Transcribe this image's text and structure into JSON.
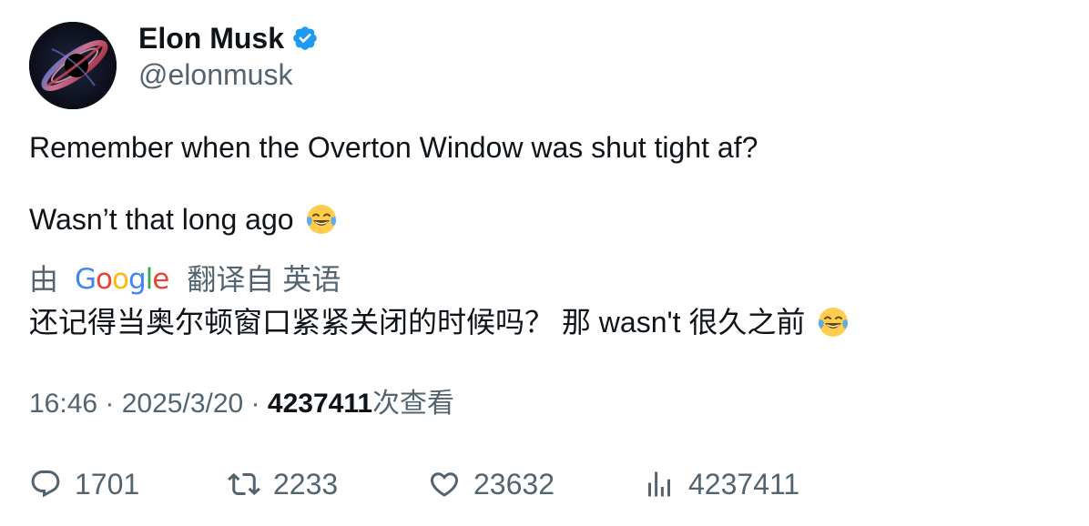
{
  "author": {
    "display_name": "Elon Musk",
    "handle": "@elonmusk",
    "verified": true,
    "verified_badge_color": "#1d9bf0"
  },
  "tweet": {
    "line1": "Remember when the Overton Window was shut tight af?",
    "line2": "Wasn’t that long ago",
    "line2_emoji": "face-with-tears-of-joy"
  },
  "translation": {
    "by_label": "由",
    "provider": [
      "G",
      "o",
      "o",
      "g",
      "l",
      "e"
    ],
    "from_label": "翻译自 英语",
    "text": "还记得当奥尔顿窗口紧紧关闭的时候吗？ 那 wasn't 很久之前",
    "emoji": "face-with-tears-of-joy"
  },
  "meta": {
    "time": "16:46",
    "separator1": " · ",
    "date": "2025/3/20",
    "separator2": " · ",
    "views": "4237411",
    "views_suffix": "次查看"
  },
  "actions": {
    "replies": "1701",
    "retweets": "2233",
    "likes": "23632",
    "views": "4237411",
    "icons": [
      "reply-icon",
      "retweet-icon",
      "like-icon",
      "views-icon"
    ],
    "icon_color": "#536471"
  }
}
